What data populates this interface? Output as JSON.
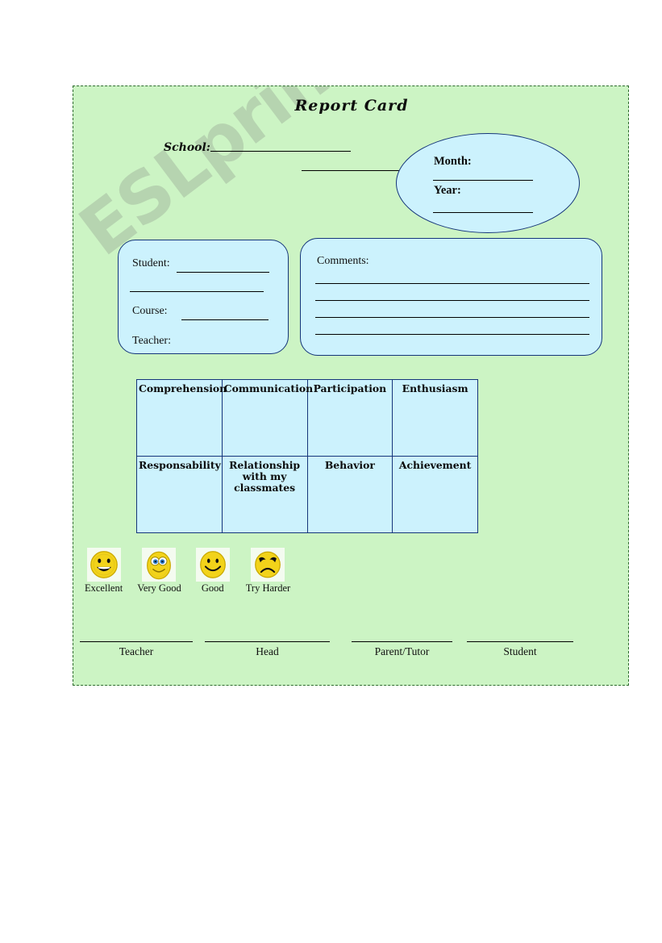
{
  "document": {
    "title": "Report  Card",
    "watermark": "ESLprintables.com"
  },
  "school": {
    "label": "School:"
  },
  "date_ellipse": {
    "month_label": "Month:",
    "year_label": "Year:"
  },
  "student_box": {
    "student_label": "Student:",
    "course_label": "Course:",
    "teacher_label": "Teacher:"
  },
  "comments_box": {
    "label": "Comments:"
  },
  "skills_table": {
    "rows": [
      [
        "Comprehension",
        "Communication",
        "Participation",
        "Enthusiasm"
      ],
      [
        "Responsability",
        "Relationship with my classmates",
        "Behavior",
        "Achievement"
      ]
    ]
  },
  "legend": {
    "items": [
      {
        "label": "Excellent",
        "icon": "grinning-face-icon"
      },
      {
        "label": "Very Good",
        "icon": "wide-eyed-smiley-face-icon"
      },
      {
        "label": "Good",
        "icon": "smiley-face-icon"
      },
      {
        "label": "Try Harder",
        "icon": "sad-face-icon"
      }
    ]
  },
  "signatures": {
    "items": [
      "Teacher",
      "Head",
      "Parent/Tutor",
      "Student"
    ]
  },
  "colors": {
    "page_background": "#ccf4c4",
    "box_fill": "#ccf2fd",
    "box_border": "#15357a",
    "page_border": "#2f6b2f",
    "face_yellow": "#f5d820",
    "watermark": "#9aa995"
  }
}
